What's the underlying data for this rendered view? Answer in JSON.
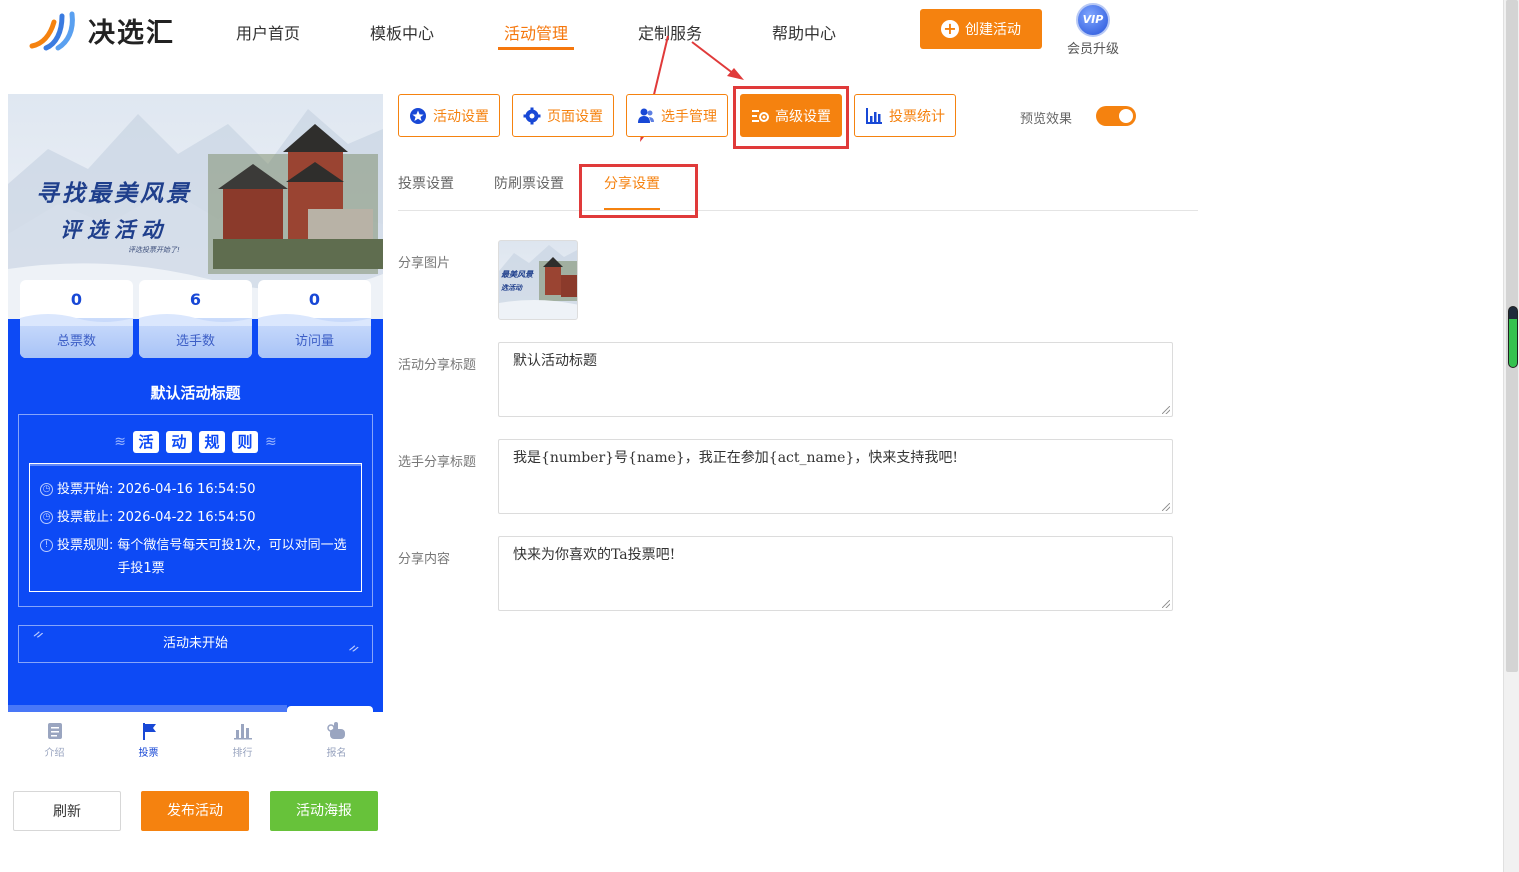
{
  "brand": {
    "name": "决选汇"
  },
  "nav": {
    "items": [
      {
        "label": "用户首页"
      },
      {
        "label": "模板中心"
      },
      {
        "label": "活动管理"
      },
      {
        "label": "定制服务"
      },
      {
        "label": "帮助中心"
      }
    ],
    "active_index": 2,
    "create_label": "创建活动",
    "vip_badge": "VIP",
    "vip_label": "会员升级"
  },
  "preview": {
    "banner_line1": "寻找最美风景",
    "banner_line2": "评选活动",
    "banner_sub": "评选投票开始了!",
    "stats": [
      {
        "value": "0",
        "label": "总票数"
      },
      {
        "value": "6",
        "label": "选手数"
      },
      {
        "value": "0",
        "label": "访问量"
      }
    ],
    "activity_title": "默认活动标题",
    "rules_chars": [
      "活",
      "动",
      "规",
      "则"
    ],
    "rules": [
      {
        "label": "投票开始:",
        "value": "2026-04-16 16:54:50"
      },
      {
        "label": "投票截止:",
        "value": "2026-04-22 16:54:50"
      },
      {
        "label": "投票规则:",
        "value": "每个微信号每天可投1次，可以对同一选手投1票"
      }
    ],
    "status": "活动未开始",
    "tabs": [
      {
        "label": "介绍",
        "icon": "document-icon"
      },
      {
        "label": "投票",
        "icon": "flag-icon"
      },
      {
        "label": "排行",
        "icon": "bar-chart-icon"
      },
      {
        "label": "报名",
        "icon": "hand-pointer-icon"
      }
    ],
    "active_tab_index": 1
  },
  "actions": {
    "refresh": "刷新",
    "publish": "发布活动",
    "poster": "活动海报"
  },
  "toolbar": {
    "buttons": [
      {
        "label": "活动设置",
        "icon": "star-icon"
      },
      {
        "label": "页面设置",
        "icon": "gear-icon"
      },
      {
        "label": "选手管理",
        "icon": "users-icon"
      },
      {
        "label": "高级设置",
        "icon": "sliders-icon"
      },
      {
        "label": "投票统计",
        "icon": "bar-chart-icon"
      }
    ],
    "active_index": 3,
    "preview_label": "预览效果",
    "preview_on": true
  },
  "subtabs": {
    "items": [
      {
        "label": "投票设置"
      },
      {
        "label": "防刷票设置"
      },
      {
        "label": "分享设置"
      }
    ],
    "active_index": 2
  },
  "share": {
    "image_label": "分享图片",
    "image_text_line1": "最美风景",
    "image_text_line2": "选活动",
    "title_label": "活动分享标题",
    "title_value": "默认活动标题",
    "player_title_label": "选手分享标题",
    "player_title_value": "我是{number}号{name}，我正在参加{act_name}，快来支持我吧!",
    "content_label": "分享内容",
    "content_value": "快来为你喜欢的Ta投票吧!"
  },
  "colors": {
    "accent": "#f5820f",
    "phone_blue": "#0d4af5",
    "highlight_red": "#e03a3a",
    "poster_green": "#67c23a"
  }
}
